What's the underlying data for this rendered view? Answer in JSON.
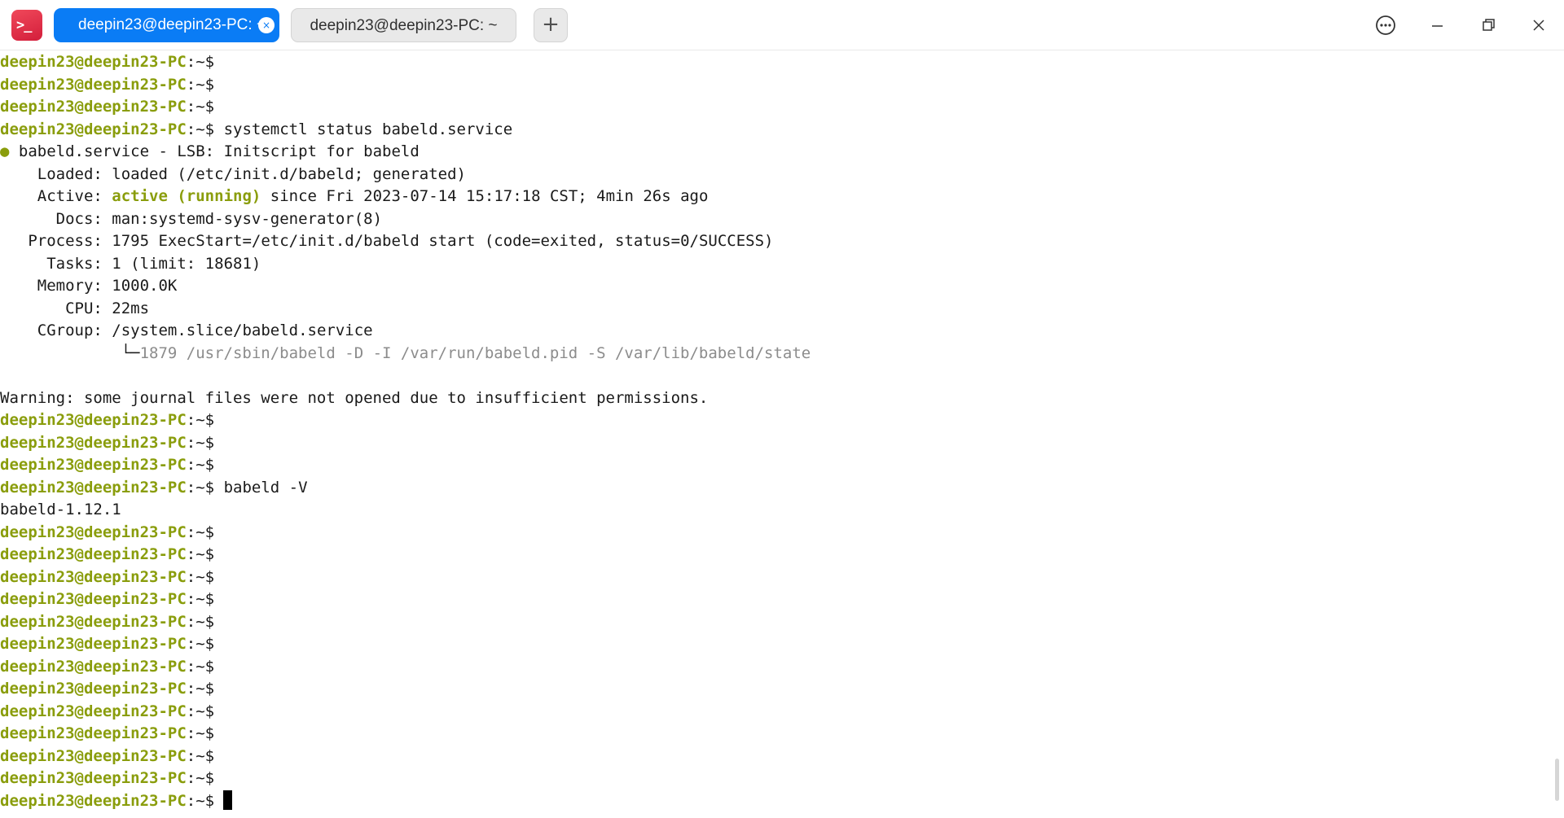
{
  "titlebar": {
    "tabs": [
      {
        "label": "deepin23@deepin23-PC: ~",
        "active": true
      },
      {
        "label": "deepin23@deepin23-PC: ~",
        "active": false
      }
    ],
    "close_tab_glyph": "×",
    "add_tab_glyph": "+",
    "app_icon_glyph": ">_",
    "icons": {
      "app": "terminal-app-icon",
      "menu": "more-options-icon",
      "minimize": "minimize-icon",
      "restore": "restore-icon",
      "close": "close-icon"
    },
    "accent_color": "#0a7cf5"
  },
  "terminal": {
    "prompt_user": "deepin23@deepin23-PC",
    "prompt_sep": ":~$",
    "prompt_color": "#8a9d0c",
    "commands": {
      "c1": "systemctl status babeld.service",
      "c2": "babeld -V"
    },
    "status": {
      "header": "babeld.service - LSB: Initscript for babeld",
      "bullet": "●",
      "loaded_label": "    Loaded:",
      "loaded_value": "loaded (/etc/init.d/babeld; generated)",
      "active_label": "    Active:",
      "active_state": "active (running)",
      "active_rest": "since Fri 2023-07-14 15:17:18 CST; 4min 26s ago",
      "docs_label": "      Docs:",
      "docs_value": "man:systemd-sysv-generator(8)",
      "process_label": "   Process:",
      "process_value": "1795 ExecStart=/etc/init.d/babeld start (code=exited, status=0/SUCCESS)",
      "tasks_label": "     Tasks:",
      "tasks_value": "1 (limit: 18681)",
      "memory_label": "    Memory:",
      "memory_value": "1000.0K",
      "cpu_label": "       CPU:",
      "cpu_value": "22ms",
      "cgroup_label": "    CGroup:",
      "cgroup_value": "/system.slice/babeld.service",
      "tree_prefix": "             └─",
      "tree_value": "1879 /usr/sbin/babeld -D -I /var/run/babeld.pid -S /var/lib/babeld/state"
    },
    "warning": "Warning: some journal files were not opened due to insufficient permissions.",
    "version_output": "babeld-1.12.1"
  }
}
